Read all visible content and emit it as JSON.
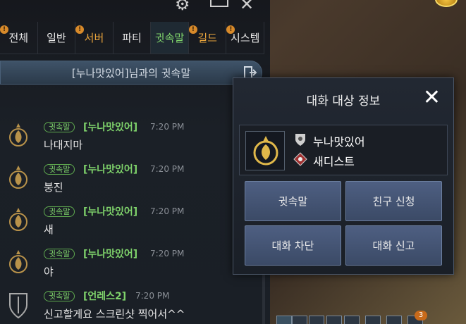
{
  "tabs": [
    {
      "label": "전체",
      "badge": "!"
    },
    {
      "label": "일반",
      "badge": ""
    },
    {
      "label": "서버",
      "badge": "!"
    },
    {
      "label": "파티",
      "badge": ""
    },
    {
      "label": "귓속말",
      "badge": ""
    },
    {
      "label": "길드",
      "badge": "!"
    },
    {
      "label": "시스템",
      "badge": "!"
    }
  ],
  "whisper_bar": {
    "label": "[누나맛있어]님과의 귓속말"
  },
  "messages": [
    {
      "tag": "귓속말",
      "sender": "[누나맛있어]",
      "time": "7:20 PM",
      "text": "나대지마"
    },
    {
      "tag": "귓속말",
      "sender": "[누나맛있어]",
      "time": "7:20 PM",
      "text": "붕진"
    },
    {
      "tag": "귓속말",
      "sender": "[누나맛있어]",
      "time": "7:20 PM",
      "text": "새"
    },
    {
      "tag": "귓속말",
      "sender": "[누나맛있어]",
      "time": "7:20 PM",
      "text": "야"
    },
    {
      "tag": "귓속말",
      "sender": "[언레스2]",
      "time": "7:20 PM",
      "text": "신고할게요 스크린샷 찍어서^^"
    }
  ],
  "popup": {
    "title": "대화 대상 정보",
    "close": "✕",
    "name": "누나맛있어",
    "class_name": "새디스트",
    "buttons": {
      "whisper": "귓속말",
      "friend": "친구 신청",
      "block": "대화 차단",
      "report": "대화 신고"
    }
  },
  "bottom_badge": "3",
  "colors": {
    "accent_green": "#7fd36b",
    "orange": "#e8a43c",
    "button_blue": "#4e5f82"
  }
}
